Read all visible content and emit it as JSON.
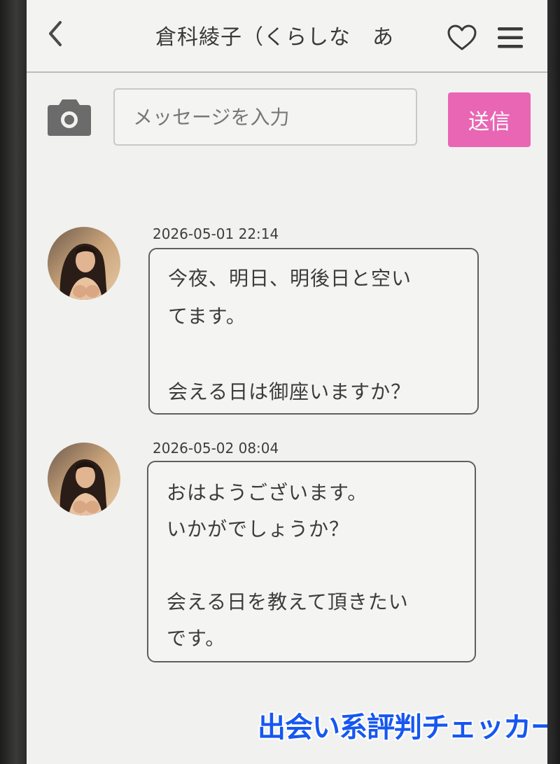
{
  "header": {
    "back_icon": "chevron-left-icon",
    "title": "倉科綾子（くらしな　あ",
    "favorite_icon": "heart-outline-icon",
    "menu_icon": "hamburger-menu-icon"
  },
  "composer": {
    "camera_icon": "camera-icon",
    "placeholder": "メッセージを入力",
    "value": "",
    "send_label": "送信",
    "send_color": "#e866b4"
  },
  "messages": [
    {
      "timestamp": "2026-05-01 22:14",
      "lines": [
        "今夜、明日、明後日と空い",
        "てます。",
        "",
        "会える日は御座いますか？"
      ]
    },
    {
      "timestamp": "2026-05-02 08:04",
      "lines": [
        "おはようございます。",
        "いかがでしょうか？",
        "",
        "会える日を教えて頂きたい",
        "です。"
      ]
    }
  ],
  "watermark": "出会い系評判チェッカー"
}
